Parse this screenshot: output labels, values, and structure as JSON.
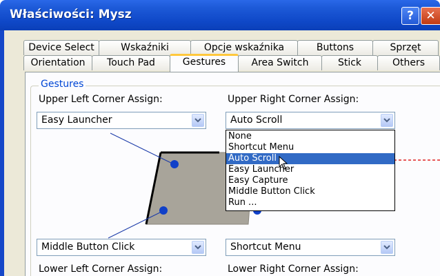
{
  "window": {
    "title": "Właściwości: Mysz",
    "help_glyph": "?",
    "close_glyph": "✕"
  },
  "tabs": {
    "row1": [
      {
        "label": "Device Select"
      },
      {
        "label": "Wskaźniki"
      },
      {
        "label": "Opcje wskaźnika"
      },
      {
        "label": "Buttons"
      },
      {
        "label": "Sprzęt"
      }
    ],
    "row2": [
      {
        "label": "Orientation"
      },
      {
        "label": "Touch Pad"
      },
      {
        "label": "Gestures",
        "active": true
      },
      {
        "label": "Area Switch"
      },
      {
        "label": "Stick"
      },
      {
        "label": "Others"
      }
    ]
  },
  "gestures": {
    "group_label": "Gestures",
    "upper_left": {
      "label": "Upper Left Corner Assign:",
      "value": "Easy Launcher"
    },
    "upper_right": {
      "label": "Upper Right Corner Assign:",
      "value": "Auto Scroll"
    },
    "lower_left": {
      "label": "Lower Left Corner Assign:",
      "value": "Middle Button Click"
    },
    "lower_right": {
      "label": "Lower Right Corner Assign:",
      "value": "Shortcut Menu"
    },
    "dropdown_options": [
      "None",
      "Shortcut Menu",
      "Auto Scroll",
      "Easy Launcher",
      "Easy Capture",
      "Middle Button Click",
      "Run ..."
    ],
    "dropdown_selected": "Auto Scroll"
  },
  "colors": {
    "titlebar": "#0f48c8",
    "selection": "#316ac5",
    "active_tab_accent": "#ffc83c",
    "annotation_arrow": "#e02020",
    "corner_dot": "#1040c8"
  },
  "icons": {
    "combo_arrow": "chevron-down-icon",
    "cursor": "mouse-pointer-icon"
  }
}
